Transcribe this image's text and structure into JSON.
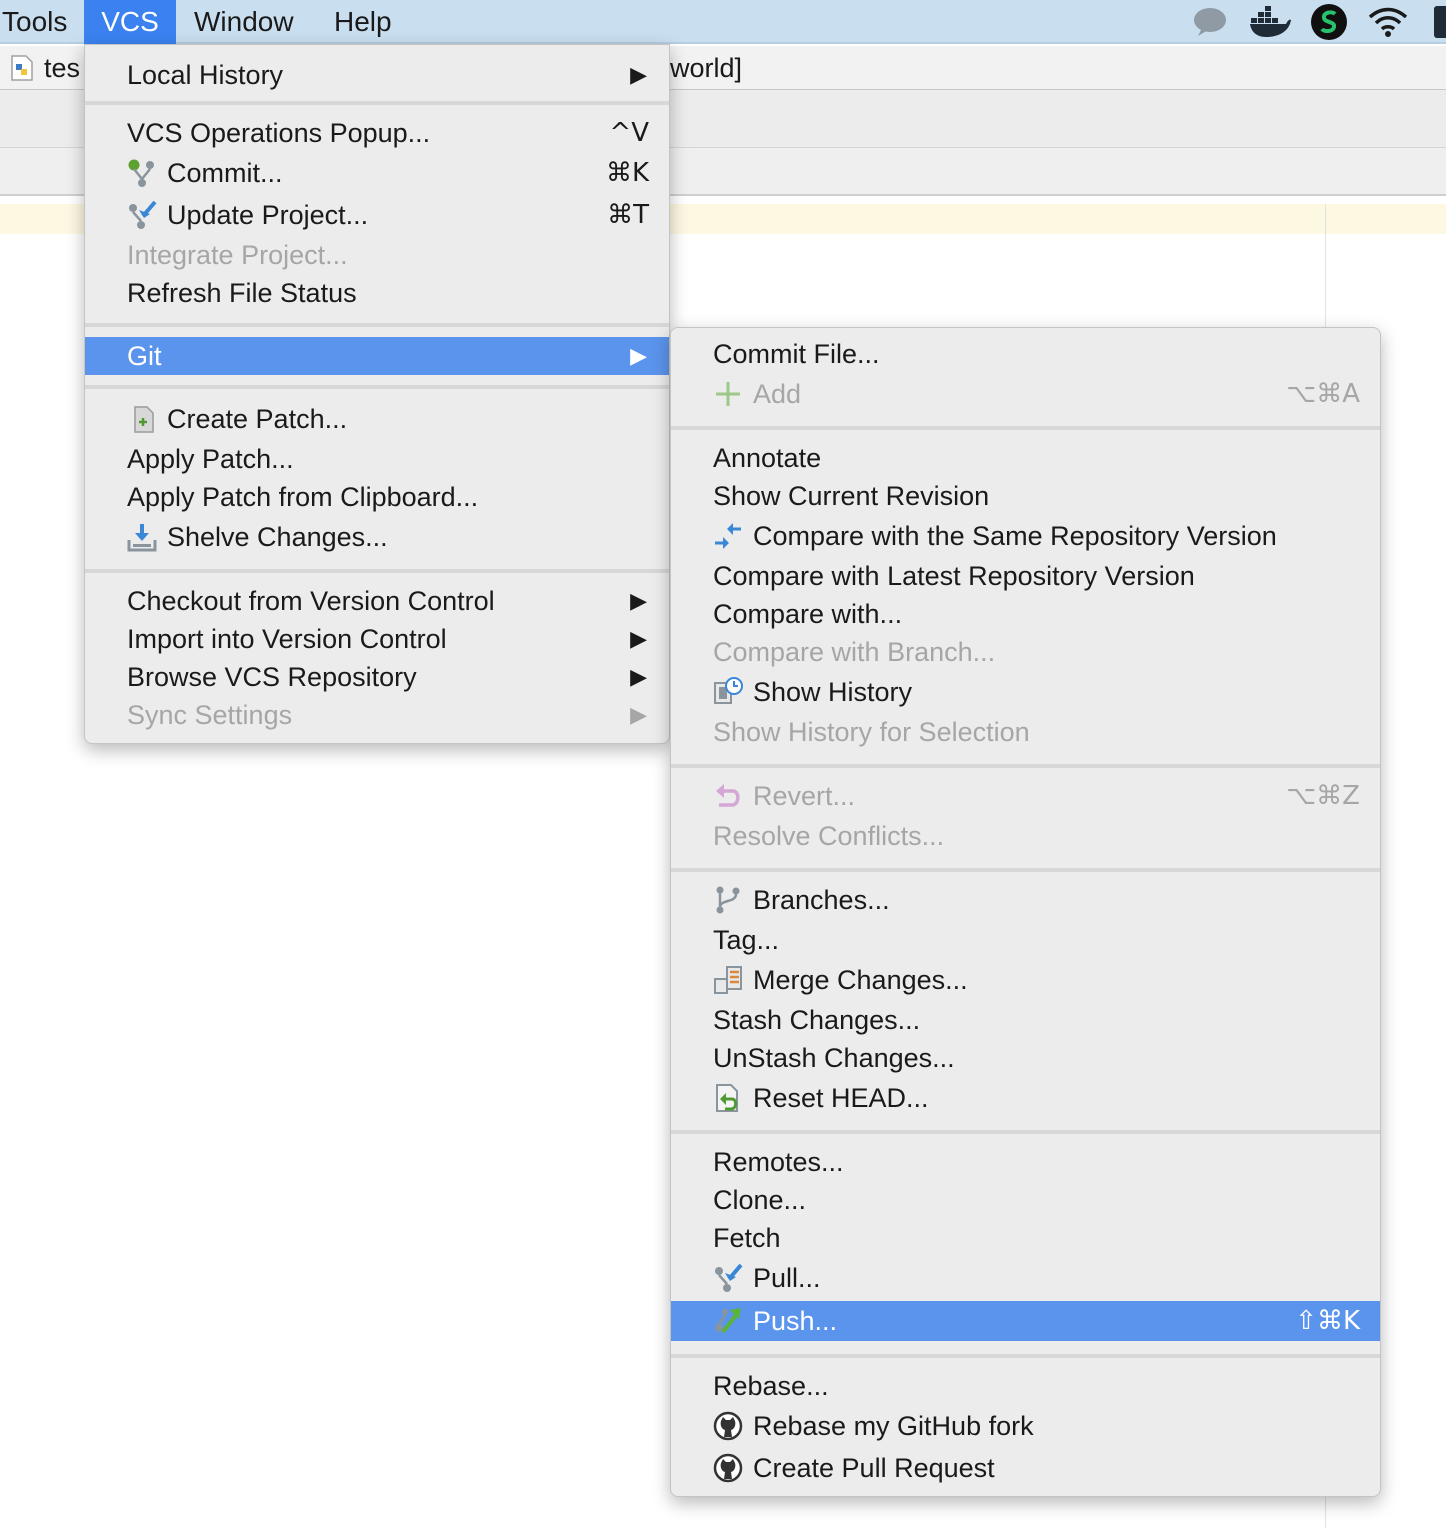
{
  "menubar": {
    "items": [
      "Tools",
      "VCS",
      "Window",
      "Help"
    ],
    "active_index": 1
  },
  "tab": {
    "left_label": "tes",
    "right_label": "world]"
  },
  "vcs_menu": {
    "local_history": "Local History",
    "vcs_operations_popup": "VCS Operations Popup...",
    "vcs_operations_popup_shortcut": "^V",
    "commit": "Commit...",
    "commit_shortcut": "⌘K",
    "update_project": "Update Project...",
    "update_project_shortcut": "⌘T",
    "integrate_project": "Integrate Project...",
    "refresh_file_status": "Refresh File Status",
    "git": "Git",
    "create_patch": "Create Patch...",
    "apply_patch": "Apply Patch...",
    "apply_patch_clipboard": "Apply Patch from Clipboard...",
    "shelve_changes": "Shelve Changes...",
    "checkout": "Checkout from Version Control",
    "import": "Import into Version Control",
    "browse": "Browse VCS Repository",
    "sync_settings": "Sync Settings"
  },
  "git_menu": {
    "commit_file": "Commit File...",
    "add": "Add",
    "add_shortcut": "⌥⌘A",
    "annotate": "Annotate",
    "show_current_revision": "Show Current Revision",
    "compare_same": "Compare with the Same Repository Version",
    "compare_latest": "Compare with Latest Repository Version",
    "compare_with": "Compare with...",
    "compare_branch": "Compare with Branch...",
    "show_history": "Show History",
    "show_history_selection": "Show History for Selection",
    "revert": "Revert...",
    "revert_shortcut": "⌥⌘Z",
    "resolve_conflicts": "Resolve Conflicts...",
    "branches": "Branches...",
    "tag": "Tag...",
    "merge_changes": "Merge Changes...",
    "stash_changes": "Stash Changes...",
    "unstash_changes": "UnStash Changes...",
    "reset_head": "Reset HEAD...",
    "remotes": "Remotes...",
    "clone": "Clone...",
    "fetch": "Fetch",
    "pull": "Pull...",
    "push": "Push...",
    "push_shortcut": "⇧⌘K",
    "rebase": "Rebase...",
    "rebase_github_fork": "Rebase my GitHub fork",
    "create_pull_request": "Create Pull Request"
  },
  "colors": {
    "menubar_bg": "#c9dff0",
    "menubar_active": "#3b82f0",
    "menu_bg": "#ececec",
    "selection": "#5b94ec",
    "disabled_text": "#a6a6a6"
  }
}
